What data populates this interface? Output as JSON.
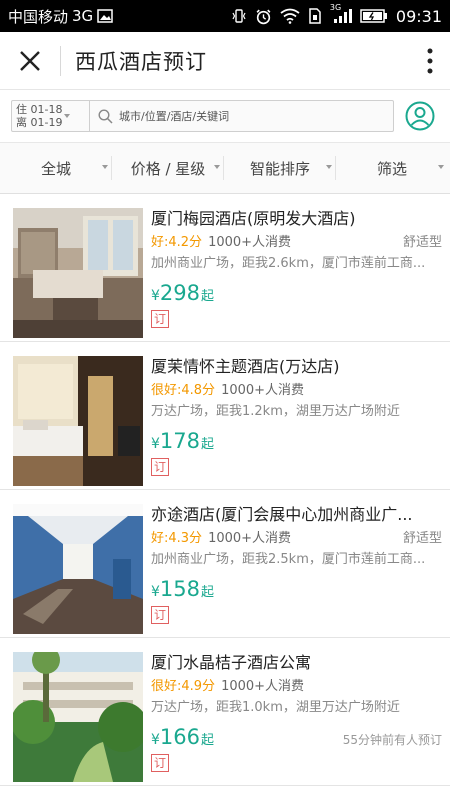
{
  "status_bar": {
    "carrier": "中国移动",
    "network": "3G",
    "signal_type": "3G",
    "time": "09:31"
  },
  "header": {
    "title": "西瓜酒店预订"
  },
  "search": {
    "checkin": "住 01-18",
    "checkout": "离 01-19",
    "placeholder": "城市/位置/酒店/关键词"
  },
  "filters": [
    {
      "label": "全城"
    },
    {
      "label": "价格 / 星级"
    },
    {
      "label": "智能排序"
    },
    {
      "label": "筛选"
    }
  ],
  "hotels": [
    {
      "name": "厦门梅园酒店(原明发大酒店)",
      "rating": "好:4.2分",
      "consumption": "1000+人消费",
      "type": "舒适型",
      "location": "加州商业广场，距我2.6km，厦门市莲前工商...",
      "currency": "¥",
      "price": "298",
      "price_suffix": "起",
      "recent": "",
      "book_label": "订"
    },
    {
      "name": "厦茉情怀主题酒店(万达店)",
      "rating": "很好:4.8分",
      "consumption": "1000+人消费",
      "type": "",
      "location": "万达广场，距我1.2km，湖里万达广场附近",
      "currency": "¥",
      "price": "178",
      "price_suffix": "起",
      "recent": "",
      "book_label": "订"
    },
    {
      "name": "亦途酒店(厦门会展中心加州商业广...",
      "rating": "好:4.3分",
      "consumption": "1000+人消费",
      "type": "舒适型",
      "location": "加州商业广场，距我2.5km，厦门市莲前工商...",
      "currency": "¥",
      "price": "158",
      "price_suffix": "起",
      "recent": "",
      "book_label": "订"
    },
    {
      "name": "厦门水晶桔子酒店公寓",
      "rating": "很好:4.9分",
      "consumption": "1000+人消费",
      "type": "",
      "location": "万达广场，距我1.0km，湖里万达广场附近",
      "currency": "¥",
      "price": "166",
      "price_suffix": "起",
      "recent": "55分钟前有人预订",
      "book_label": "订"
    }
  ],
  "colors": {
    "accent": "#1aa88f",
    "rating": "#f39800",
    "book": "#e06060"
  }
}
